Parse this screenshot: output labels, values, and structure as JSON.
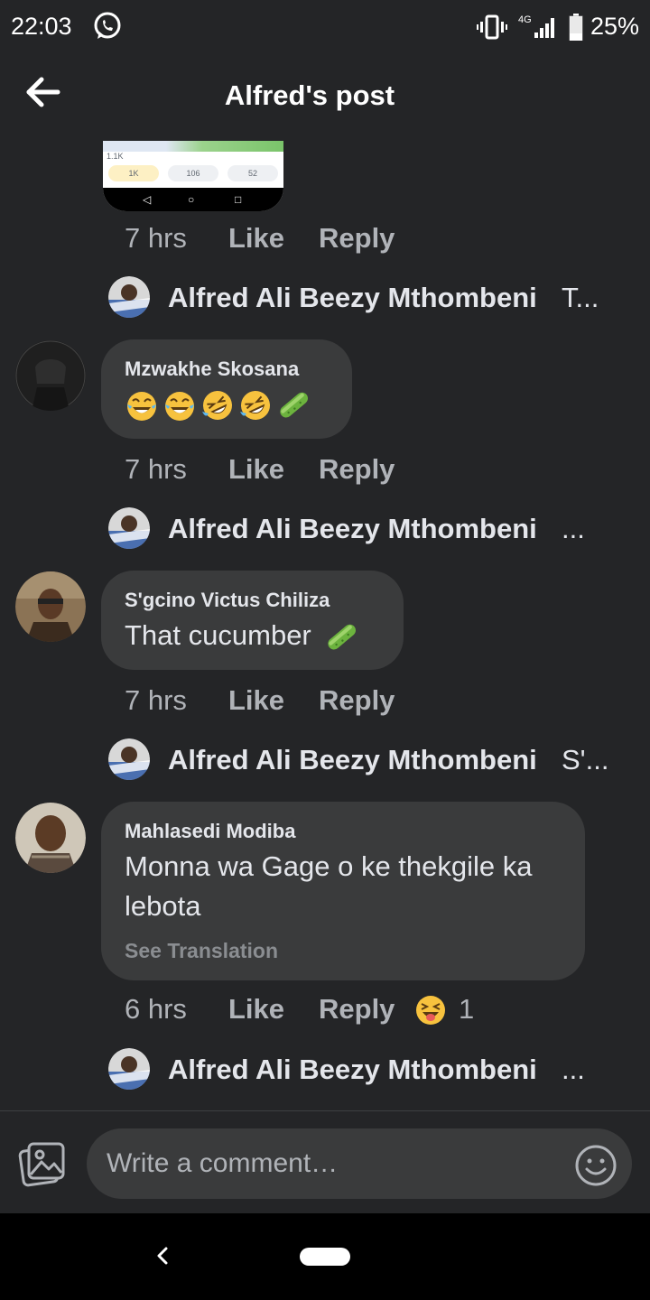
{
  "status_bar": {
    "time": "22:03",
    "network": "4G",
    "battery": "25%",
    "icons": [
      "whatsapp-icon",
      "vibrate-icon",
      "signal-icon",
      "battery-icon"
    ]
  },
  "header": {
    "title": "Alfred's post",
    "back_icon": "arrow-left-icon"
  },
  "preview_thumbnail": {
    "reactions": "1.1K",
    "pills": [
      "1K",
      "106",
      "52"
    ]
  },
  "comments": [
    {
      "meta": {
        "time": "7 hrs",
        "like": "Like",
        "reply": "Reply"
      },
      "reply_preview": {
        "name": "Alfred Ali Beezy Mthombeni",
        "preview": "T..."
      }
    },
    {
      "author": "Mzwakhe Skosana",
      "emojis": [
        "joy",
        "joy",
        "rofl",
        "rofl",
        "cucumber"
      ],
      "meta": {
        "time": "7 hrs",
        "like": "Like",
        "reply": "Reply"
      },
      "reply_preview": {
        "name": "Alfred Ali Beezy Mthombeni",
        "preview": "..."
      }
    },
    {
      "author": "S'gcino Victus Chiliza",
      "text": "That cucumber",
      "text_emoji": "cucumber",
      "meta": {
        "time": "7 hrs",
        "like": "Like",
        "reply": "Reply"
      },
      "reply_preview": {
        "name": "Alfred Ali Beezy Mthombeni",
        "preview": "S'..."
      }
    },
    {
      "author": "Mahlasedi Modiba",
      "text_lines": [
        "Monna wa Gage o ke thekgile ka",
        "lebota"
      ],
      "see_translation": "See Translation",
      "meta": {
        "time": "6 hrs",
        "like": "Like",
        "reply": "Reply",
        "reaction": "squinting-face-tongue",
        "reaction_count": "1"
      },
      "reply_preview": {
        "name": "Alfred Ali Beezy Mthombeni",
        "preview": "..."
      }
    }
  ],
  "composer": {
    "placeholder": "Write a comment…",
    "photo_icon": "photo-icon",
    "emoji_icon": "smiley-icon"
  },
  "colors": {
    "background": "#242527",
    "bubble": "#3a3b3c",
    "text": "#e4e6eb",
    "secondary_text": "#b0b3b8"
  }
}
